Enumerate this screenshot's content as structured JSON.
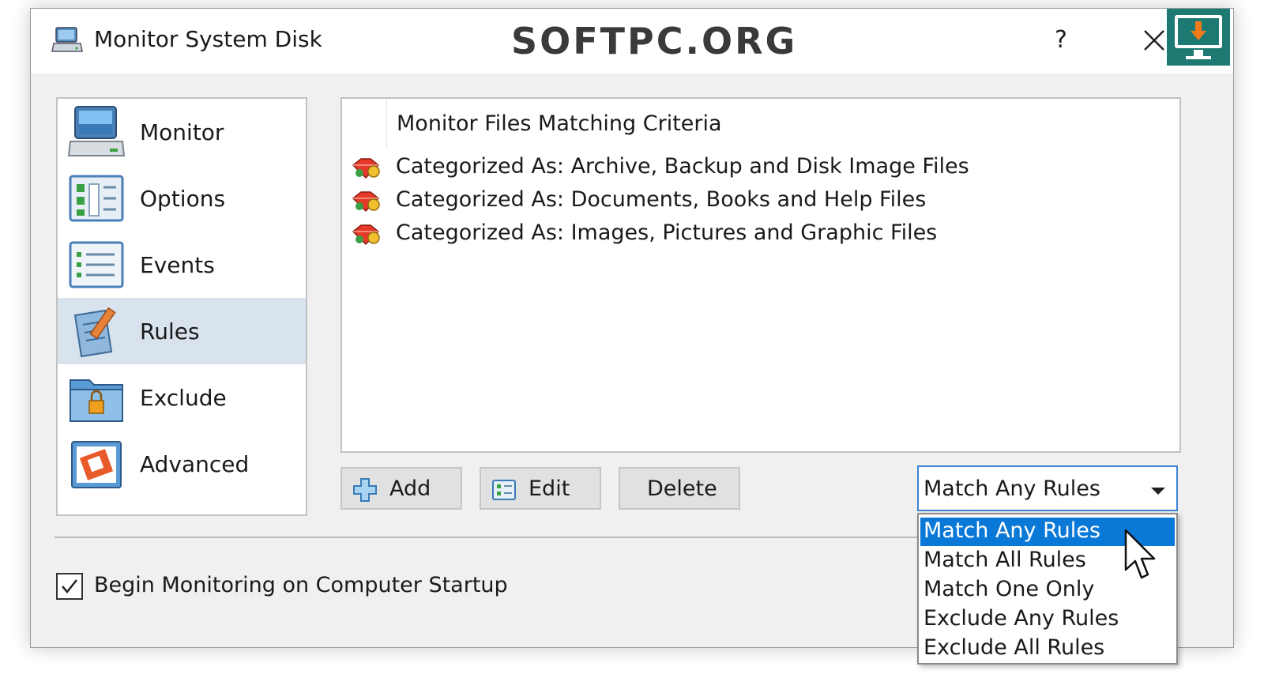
{
  "window": {
    "title": "Monitor System Disk",
    "watermark": "SOFTPC.ORG",
    "help_label": "?"
  },
  "sidebar": {
    "items": [
      {
        "label": "Monitor",
        "icon": "monitor-icon"
      },
      {
        "label": "Options",
        "icon": "options-icon"
      },
      {
        "label": "Events",
        "icon": "events-icon"
      },
      {
        "label": "Rules",
        "icon": "rules-icon",
        "selected": true
      },
      {
        "label": "Exclude",
        "icon": "exclude-icon"
      },
      {
        "label": "Advanced",
        "icon": "advanced-icon"
      }
    ]
  },
  "rules_list": {
    "header": "Monitor Files Matching Criteria",
    "rows": [
      {
        "label": "Categorized As: Archive, Backup and Disk Image Files",
        "icon": "rule-gem-icon"
      },
      {
        "label": "Categorized As: Documents, Books and Help Files",
        "icon": "rule-gem-icon"
      },
      {
        "label": "Categorized As: Images, Pictures and Graphic Files",
        "icon": "rule-gem-icon"
      }
    ]
  },
  "buttons": {
    "add": "Add",
    "edit": "Edit",
    "delete": "Delete"
  },
  "match_mode": {
    "selected": "Match Any Rules",
    "options": [
      "Match Any Rules",
      "Match All Rules",
      "Match One Only",
      "Exclude Any Rules",
      "Exclude All Rules"
    ]
  },
  "startup": {
    "label": "Begin Monitoring on Computer Startup",
    "checked": true
  },
  "colors": {
    "accent": "#0a78d7",
    "selected_nav": "#d9e3ee",
    "window_bg": "#f0f0f0"
  }
}
